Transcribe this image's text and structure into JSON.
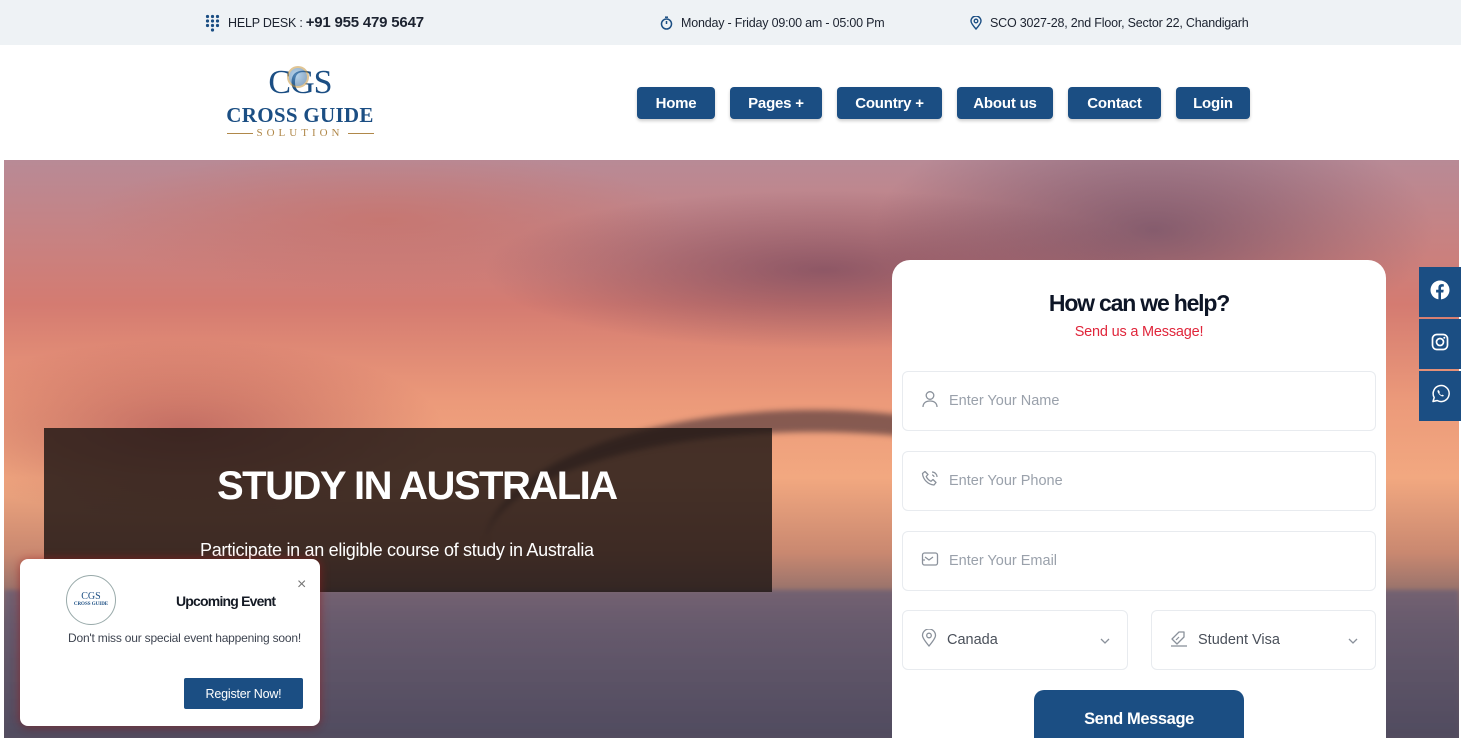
{
  "topbar": {
    "helpdesk_label": "HELP DESK :",
    "helpdesk_phone": "+91 955 479 5647",
    "hours": "Monday - Friday 09:00 am - 05:00 Pm",
    "address": "SCO 3027-28, 2nd Floor, Sector 22, Chandigarh"
  },
  "logo": {
    "monogram": "CGS",
    "name": "CROSS GUIDE",
    "sub": "SOLUTION"
  },
  "nav": {
    "items": [
      {
        "label": "Home"
      },
      {
        "label": "Pages +"
      },
      {
        "label": "Country +"
      },
      {
        "label": "About us"
      },
      {
        "label": "Contact"
      },
      {
        "label": "Login"
      }
    ]
  },
  "hero": {
    "title": "STUDY IN AUSTRALIA",
    "subtitle": "Participate in an eligible course of study in Australia"
  },
  "form": {
    "title": "How can we help?",
    "tagline": "Send us a Message!",
    "name_placeholder": "Enter Your Name",
    "phone_placeholder": "Enter Your Phone",
    "email_placeholder": "Enter Your Email",
    "country_value": "Canada",
    "visa_value": "Student Visa",
    "submit_label": "Send Message"
  },
  "popup": {
    "logo_monogram": "CGS",
    "logo_name": "CROSS GUIDE",
    "title": "Upcoming Event",
    "close": "×",
    "message": "Don't miss our special event happening soon!",
    "button": "Register Now!"
  },
  "colors": {
    "brand": "#1b4e83",
    "accent": "#e0263b",
    "topbar_bg": "#eef2f5"
  }
}
